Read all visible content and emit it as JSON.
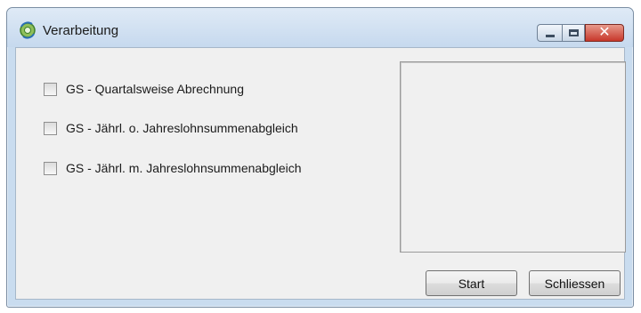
{
  "window": {
    "title": "Verarbeitung",
    "icon": "gear-refresh-icon",
    "caption_buttons": {
      "minimize": "minimize-icon",
      "maximize": "maximize-icon",
      "close_glyph": "✕"
    }
  },
  "options": [
    {
      "label": "GS - Quartalsweise Abrechnung",
      "checked": false
    },
    {
      "label": "GS - Jährl. o. Jahreslohnsummenabgleich",
      "checked": false
    },
    {
      "label": "GS - Jährl. m. Jahreslohnsummenabgleich",
      "checked": false
    }
  ],
  "buttons": {
    "start": "Start",
    "close": "Schliessen"
  },
  "colors": {
    "accent_close": "#c7372a",
    "frame": "#c9dcef",
    "client": "#f0f0f0"
  }
}
